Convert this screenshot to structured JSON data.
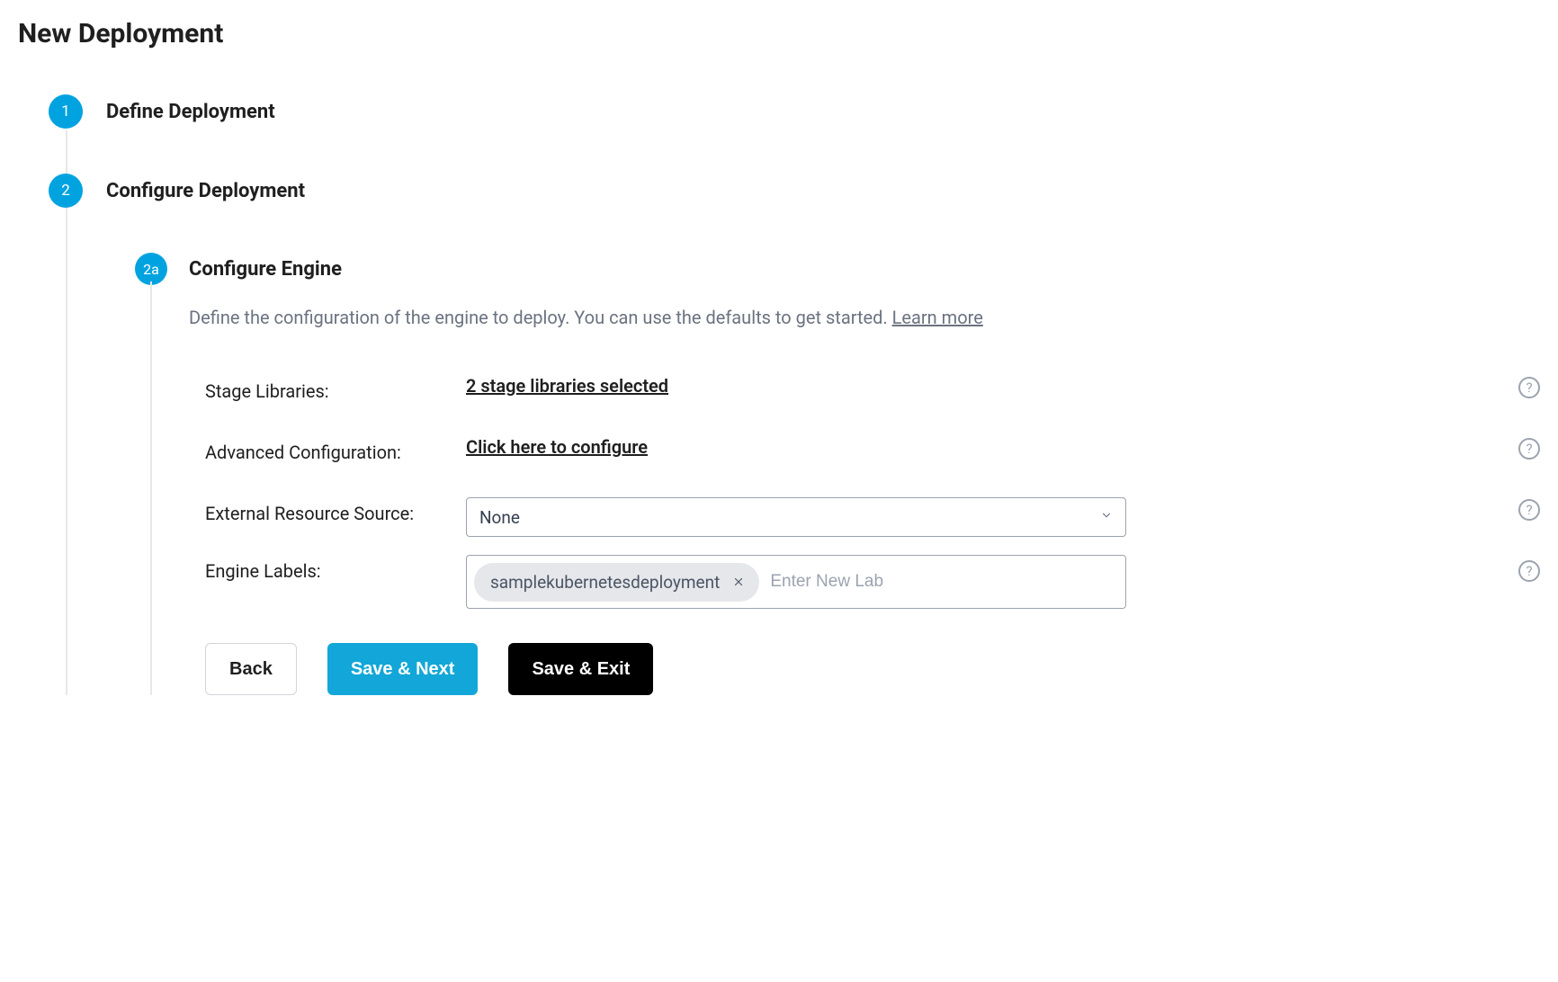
{
  "page": {
    "title": "New Deployment"
  },
  "steps": {
    "one": {
      "num": "1",
      "label": "Define Deployment"
    },
    "two": {
      "num": "2",
      "label": "Configure Deployment"
    }
  },
  "substep": {
    "num": "2a",
    "title": "Configure Engine",
    "desc_prefix": "Define the configuration of the engine to deploy. You can use the defaults to get started. ",
    "learn_more": "Learn more"
  },
  "form": {
    "stage_libraries": {
      "label": "Stage Libraries:",
      "value": "2 stage libraries selected"
    },
    "advanced_config": {
      "label": "Advanced Configuration:",
      "value": "Click here to configure"
    },
    "ext_resource": {
      "label": "External Resource Source:",
      "selected": "None"
    },
    "engine_labels": {
      "label": "Engine Labels:",
      "tags": [
        "samplekubernetesdeployment"
      ],
      "placeholder": "Enter New Lab"
    }
  },
  "buttons": {
    "back": "Back",
    "save_next": "Save & Next",
    "save_exit": "Save & Exit"
  },
  "help_glyph": "?"
}
